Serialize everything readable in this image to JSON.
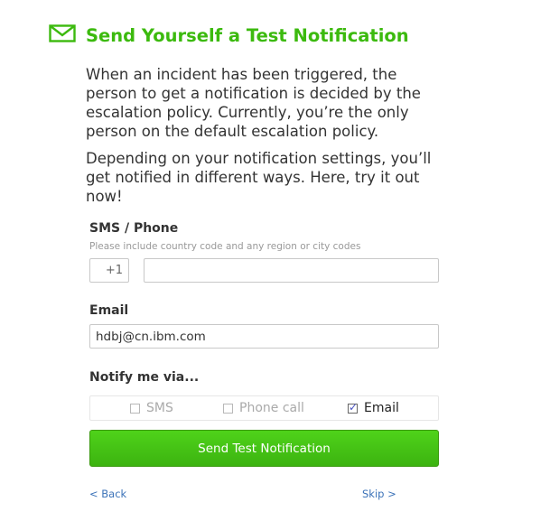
{
  "header": {
    "icon": "envelope-icon",
    "title": "Send Yourself a Test Notification",
    "accent_color": "#3cba0e"
  },
  "intro": {
    "paragraph1": "When an incident has been triggered, the person to get a notification is decided by the escalation policy. Currently, you’re the only person on the default escalation policy.",
    "paragraph2": "Depending on your notification settings, you’ll get notified in different ways. Here, try it out now!"
  },
  "phone": {
    "label": "SMS / Phone",
    "hint": "Please include country code and any region or city codes",
    "country_code": "+1",
    "number": ""
  },
  "email": {
    "label": "Email",
    "value": "hdbj@cn.ibm.com"
  },
  "notify": {
    "label": "Notify me via...",
    "options": [
      {
        "label": "SMS",
        "checked": false
      },
      {
        "label": "Phone call",
        "checked": false
      },
      {
        "label": "Email",
        "checked": true
      }
    ]
  },
  "actions": {
    "send_label": "Send Test Notification",
    "back_label": "< Back",
    "skip_label": "Skip >",
    "link_color": "#3b72b8"
  }
}
